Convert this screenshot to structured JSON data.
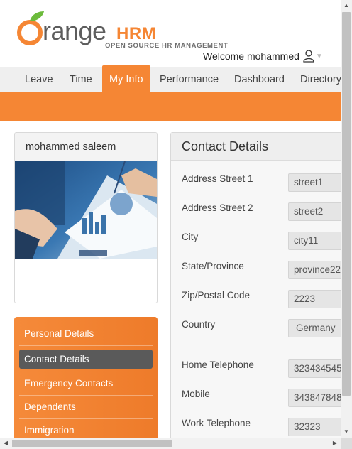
{
  "brand": {
    "name_main": "range",
    "name_hrm": "HRM",
    "tagline": "OPEN SOURCE HR MANAGEMENT",
    "accent_color": "#f58634",
    "leaf_color": "#6cbb3c"
  },
  "header": {
    "welcome": "Welcome mohammed",
    "user_icon": "user-icon",
    "dropdown_icon": "chevron-down-icon"
  },
  "nav": {
    "tabs": [
      {
        "label": "Leave"
      },
      {
        "label": "Time"
      },
      {
        "label": "My Info",
        "active": true
      },
      {
        "label": "Performance"
      },
      {
        "label": "Dashboard"
      },
      {
        "label": "Directory"
      }
    ]
  },
  "profile": {
    "name": "mohammed saleem",
    "photo": "business-meeting-photo"
  },
  "side_menu": {
    "items": [
      {
        "label": "Personal Details"
      },
      {
        "label": "Contact Details",
        "active": true
      },
      {
        "label": "Emergency Contacts"
      },
      {
        "label": "Dependents"
      },
      {
        "label": "Immigration"
      }
    ]
  },
  "contact": {
    "title": "Contact Details",
    "fields": [
      {
        "label": "Address Street 1",
        "value": "street1"
      },
      {
        "label": "Address Street 2",
        "value": "street2"
      },
      {
        "label": "City",
        "value": "city11"
      },
      {
        "label": "State/Province",
        "value": "province22"
      },
      {
        "label": "Zip/Postal Code",
        "value": "2223"
      },
      {
        "label": "Country",
        "value": "Germany"
      },
      {
        "label": "Home Telephone",
        "value": "323434545"
      },
      {
        "label": "Mobile",
        "value": "343847848"
      },
      {
        "label": "Work Telephone",
        "value": "32323"
      }
    ]
  }
}
